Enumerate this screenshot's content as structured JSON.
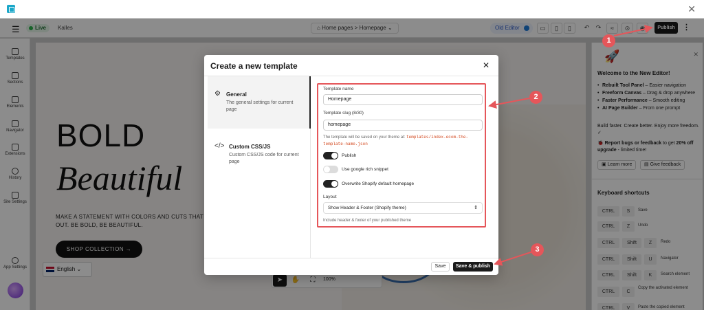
{
  "topbar": {
    "live_label": "Live",
    "store_name": "Kalles",
    "breadcrumb_home": "Home pages",
    "breadcrumb_separator": ">",
    "breadcrumb_page": "Homepage",
    "old_editor_label": "Old Editor",
    "publish_label": "Publish"
  },
  "left_sidebar": {
    "items": [
      {
        "label": "Templates"
      },
      {
        "label": "Sections"
      },
      {
        "label": "Elements"
      },
      {
        "label": "Navigator"
      },
      {
        "label": "Extensions"
      },
      {
        "label": "History"
      },
      {
        "label": "Site Settings"
      }
    ],
    "app_settings_label": "App Settings"
  },
  "canvas": {
    "hero_title_line1": "BOLD",
    "hero_title_line2": "Beautiful",
    "hero_description": "MAKE A STATEMENT WITH COLORS AND CUTS THAT STAND OUT. BE BOLD, BE BEAUTIFUL.",
    "shop_button_label": "SHOP COLLECTION →",
    "language_label": "English",
    "zoom_level": "100%"
  },
  "right_panel": {
    "welcome_title": "Welcome to the New Editor!",
    "features": [
      {
        "bold": "Rebuilt Tool Panel",
        "text": " – Easier navigation"
      },
      {
        "bold": "Freeform Canvas",
        "text": " – Drag & drop anywhere"
      },
      {
        "bold": "Faster Performance",
        "text": " – Smooth editing"
      },
      {
        "bold": "AI Page Builder",
        "text": " – From one prompt"
      }
    ],
    "tagline": "Build faster. Create better. Enjoy more freedom. ✓",
    "report_bold": "Report bugs or feedback",
    "report_middle": " to get ",
    "report_discount": "20% off upgrade",
    "report_suffix": " - limited time!",
    "learn_more_label": "Learn more",
    "give_feedback_label": "Give feedback",
    "shortcuts_heading": "Keyboard shortcuts",
    "shortcuts": [
      {
        "keys": [
          "CTRL",
          "S"
        ],
        "label": "Save"
      },
      {
        "keys": [
          "CTRL",
          "Z"
        ],
        "label": "Undo"
      },
      {
        "keys": [
          "CTRL",
          "Shift",
          "Z"
        ],
        "label": "Redo"
      },
      {
        "keys": [
          "CTRL",
          "Shift",
          "U"
        ],
        "label": "Navigator"
      },
      {
        "keys": [
          "CTRL",
          "Shift",
          "K"
        ],
        "label": "Search element"
      },
      {
        "keys": [
          "CTRL",
          "C"
        ],
        "label": "Copy the activated element"
      },
      {
        "keys": [
          "CTRL",
          "V"
        ],
        "label": "Paste the copied element"
      }
    ]
  },
  "modal": {
    "title": "Create a new template",
    "nav": [
      {
        "label": "General",
        "description": "The general settings for current page"
      },
      {
        "label": "Custom CSS/JS",
        "description": "Custom CSS/JS code for current page"
      }
    ],
    "template_name_label": "Template name",
    "template_name_value": "Homepage",
    "template_slug_label": "Template slug (8/30)",
    "template_slug_value": "homepage",
    "save_note_prefix": "The template will be saved on your theme at:",
    "save_note_path": "templates/index.ecom-the-template-name.json",
    "toggles": [
      {
        "label": "Publish",
        "on": true
      },
      {
        "label": "Use google rich snippet",
        "on": false
      },
      {
        "label": "Overwrite Shopify default homepage",
        "on": true
      }
    ],
    "layout_label": "Layout",
    "layout_value": "Show Header & Footer (Shopify theme)",
    "layout_note": "Include header & footer of your published theme",
    "save_label": "Save",
    "save_publish_label": "Save & publish"
  },
  "annotations": {
    "callout_1": "1",
    "callout_2": "2",
    "callout_3": "3",
    "color": "#e5565a"
  }
}
